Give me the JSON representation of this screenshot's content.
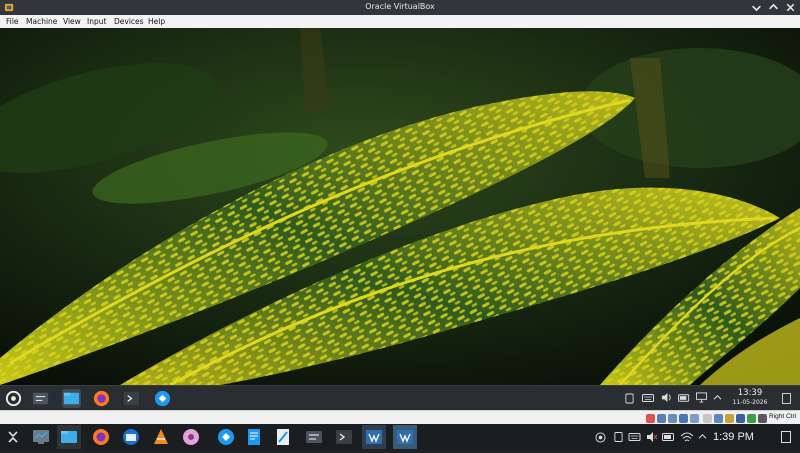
{
  "window": {
    "title": "Oracle VirtualBox",
    "controls": [
      "minimize-icon",
      "maximize-icon",
      "close-icon"
    ]
  },
  "menubar": {
    "items": [
      "File",
      "Machine",
      "View",
      "Input",
      "Devices",
      "Help"
    ]
  },
  "guest": {
    "taskbar_apps": [
      "kde-launcher-icon",
      "system-settings-icon",
      "file-manager-icon",
      "firefox-icon",
      "terminal-icon",
      "discover-icon"
    ],
    "tray_icons": [
      "clipboard-icon",
      "keyboard-icon",
      "volume-icon",
      "battery-icon",
      "display-icon",
      "chevron-up-icon"
    ],
    "clock": {
      "time": "13:39",
      "date": "11-05-2026"
    }
  },
  "statusbar": {
    "host_key": "Right Ctrl"
  },
  "host": {
    "taskbar_apps": [
      "app-launcher-icon",
      "system-monitor-icon",
      "file-manager-icon",
      "firefox-icon",
      "thunderbird-icon",
      "vlc-icon",
      "elisa-icon",
      "discover-icon",
      "kate-icon",
      "kwrite-icon",
      "settings-icon",
      "terminal-icon",
      "virtualbox-icon",
      "virtualbox-vm-icon"
    ],
    "tray_icons": [
      "record-icon",
      "clipboard-icon",
      "keyboard-icon",
      "volume-muted-icon",
      "battery-icon",
      "wifi-icon",
      "chevron-up-icon"
    ],
    "clock": {
      "time": "1:39 PM"
    },
    "colors": {
      "panel": "#1b1e20",
      "accent": "#3daee9"
    }
  }
}
